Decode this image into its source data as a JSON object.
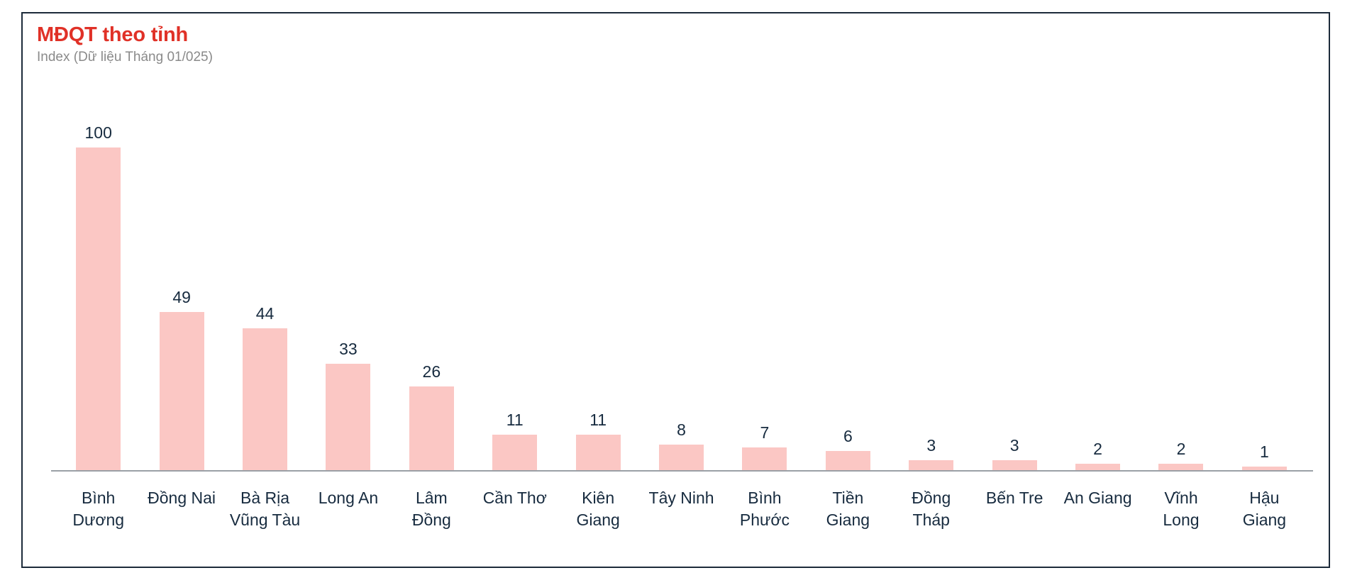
{
  "card": {
    "border_color": "#1d2b3a"
  },
  "header": {
    "title": "MĐQT theo tỉnh",
    "subtitle": "Index (Dữ liệu Tháng 01/025)",
    "title_color": "#e03127",
    "subtitle_color": "#8a8a8a"
  },
  "chart_data": {
    "type": "bar",
    "title": "MĐQT theo tỉnh",
    "subtitle": "Index (Dữ liệu Tháng 01/025)",
    "xlabel": "",
    "ylabel": "Index",
    "ylim": [
      0,
      100
    ],
    "grid": false,
    "legend": false,
    "bar_color": "#fbc7c4",
    "value_label_color": "#172b3f",
    "axis_line_color": "#9aa0a6",
    "categories": [
      "Bình Dương",
      "Đồng Nai",
      "Bà Rịa Vũng Tàu",
      "Long An",
      "Lâm Đồng",
      "Cần Thơ",
      "Kiên Giang",
      "Tây Ninh",
      "Bình Phước",
      "Tiền Giang",
      "Đồng Tháp",
      "Bến Tre",
      "An Giang",
      "Vĩnh Long",
      "Hậu Giang"
    ],
    "category_lines": [
      [
        "Bình",
        "Dương"
      ],
      [
        "Đồng Nai"
      ],
      [
        "Bà Rịa",
        "Vũng Tàu"
      ],
      [
        "Long An"
      ],
      [
        "Lâm",
        "Đồng"
      ],
      [
        "Cần Thơ"
      ],
      [
        "Kiên",
        "Giang"
      ],
      [
        "Tây Ninh"
      ],
      [
        "Bình",
        "Phước"
      ],
      [
        "Tiền",
        "Giang"
      ],
      [
        "Đồng",
        "Tháp"
      ],
      [
        "Bến Tre"
      ],
      [
        "An Giang"
      ],
      [
        "Vĩnh",
        "Long"
      ],
      [
        "Hậu",
        "Giang"
      ]
    ],
    "values": [
      100,
      49,
      44,
      33,
      26,
      11,
      11,
      8,
      7,
      6,
      3,
      3,
      2,
      2,
      1
    ]
  }
}
